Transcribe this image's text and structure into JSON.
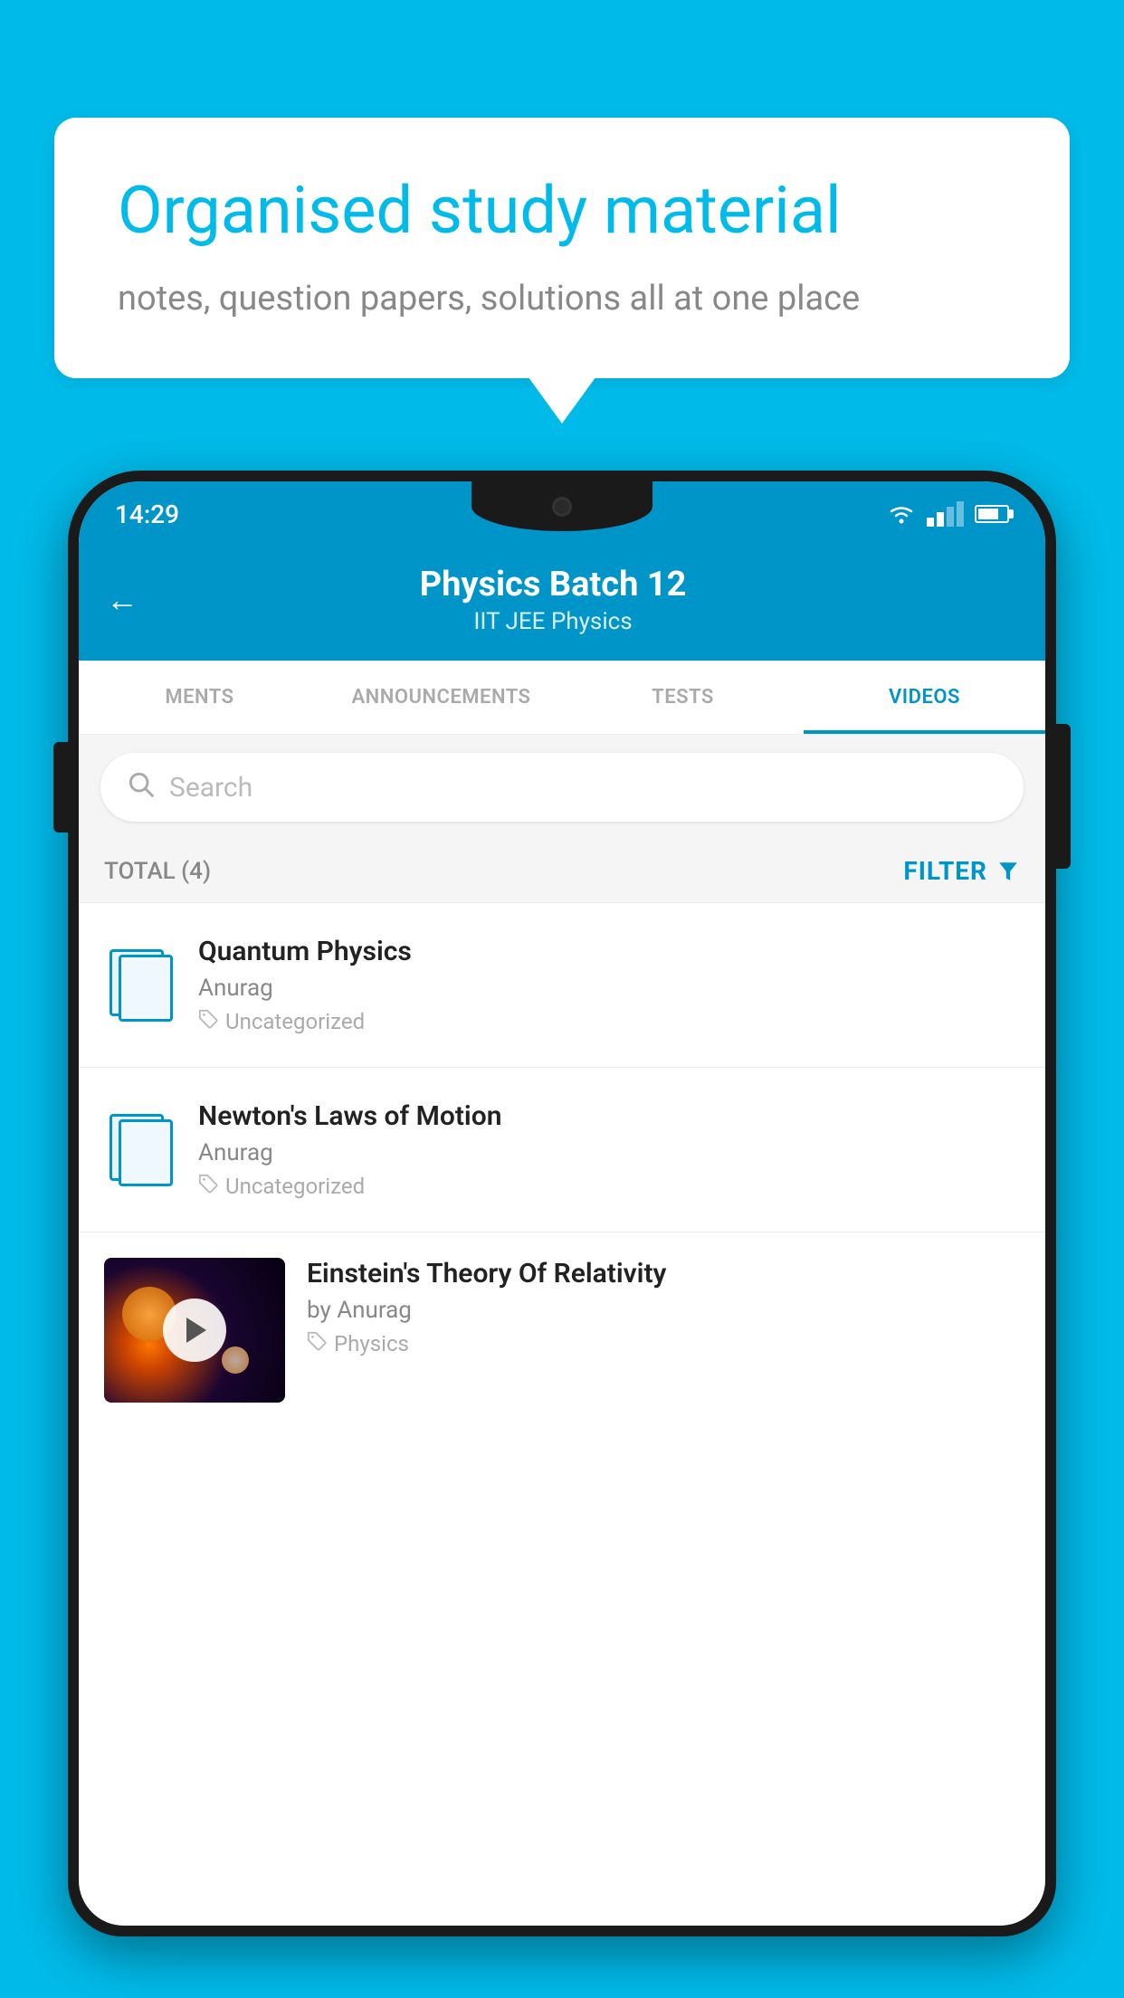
{
  "hero": {
    "title": "Organised study material",
    "subtitle": "notes, question papers, solutions all at one place"
  },
  "phone": {
    "statusBar": {
      "time": "14:29"
    },
    "header": {
      "title": "Physics Batch 12",
      "subtitle": "IIT JEE   Physics",
      "backLabel": "←"
    },
    "tabs": [
      {
        "label": "MENTS",
        "active": false
      },
      {
        "label": "ANNOUNCEMENTS",
        "active": false
      },
      {
        "label": "TESTS",
        "active": false
      },
      {
        "label": "VIDEOS",
        "active": true
      }
    ],
    "search": {
      "placeholder": "Search"
    },
    "filterRow": {
      "total": "TOTAL (4)",
      "filterLabel": "FILTER"
    },
    "videos": [
      {
        "id": 1,
        "title": "Quantum Physics",
        "author": "Anurag",
        "tag": "Uncategorized",
        "hasThumb": false
      },
      {
        "id": 2,
        "title": "Newton's Laws of Motion",
        "author": "Anurag",
        "tag": "Uncategorized",
        "hasThumb": false
      },
      {
        "id": 3,
        "title": "Einstein's Theory Of Relativity",
        "author": "by Anurag",
        "tag": "Physics",
        "hasThumb": true
      }
    ]
  }
}
